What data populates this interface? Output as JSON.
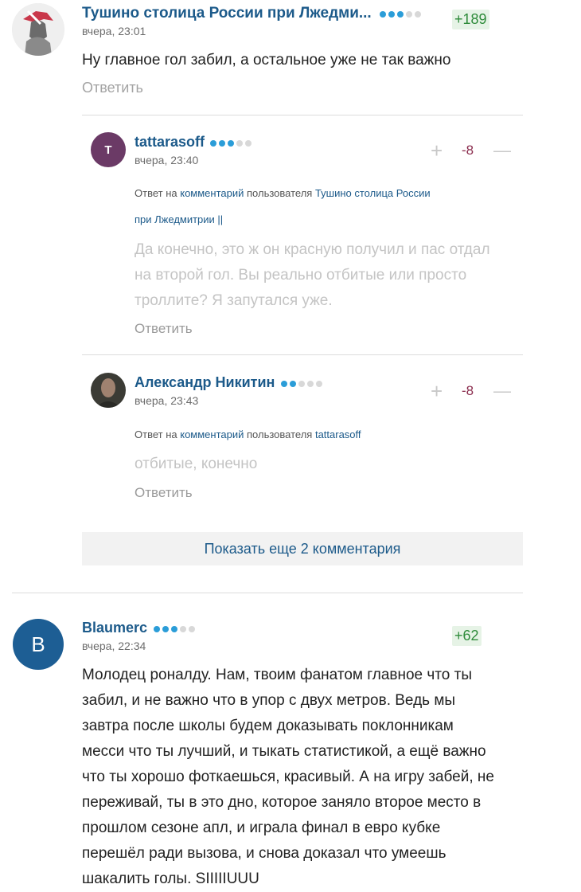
{
  "comment1": {
    "author": "Тушино столица России при Лжедми...",
    "time": "вчера, 23:01",
    "rating": "+189",
    "text": "Ну главное гол забил, а остальное уже не так важно",
    "reply_label": "Ответить",
    "level_dots": 3
  },
  "reply1": {
    "author": "tattarasoff",
    "avatar_letter": "T",
    "time": "вчера, 23:40",
    "rating": "-8",
    "meta_prefix": "Ответ на",
    "meta_link": "комментарий",
    "meta_mid": "пользователя",
    "meta_user": "Тушино столица России",
    "meta_user2": "при Лжедмитрии ||",
    "text_lines": [
      "Да конечно, это ж он красную получил и пас отдал",
      "на второй гол. Вы реально отбитые или просто",
      "троллите? Я запутался уже."
    ],
    "reply_label": "Ответить",
    "level_dots": 3
  },
  "reply2": {
    "author": "Александр Никитин",
    "time": "вчера, 23:43",
    "rating": "-8",
    "meta_prefix": "Ответ на",
    "meta_link": "комментарий",
    "meta_mid": "пользователя",
    "meta_user": "tattarasoff",
    "text": "отбитые, конечно",
    "reply_label": "Ответить",
    "level_dots": 2
  },
  "show_more": "Показать еще 2 комментария",
  "comment2": {
    "author": "Blaumerc",
    "avatar_letter": "B",
    "time": "вчера, 22:34",
    "rating": "+62",
    "text_lines": [
      "Молодец роналду. Нам, твоим фанатом главное что ты",
      "забил, и не важно что в упор с двух метров. Ведь мы",
      "завтра после школы будем доказывать поклонникам",
      "месси что ты лучший, и тыкать статистикой, а ещё важно",
      "что ты хорошо фоткаешься, красивый. А на игру забей, не",
      "переживай, ты в это дно, которое заняло второе место в",
      "прошлом сезоне апл, и играла финал в евро кубке",
      "перешёл ради вызова, и снова доказал что умеешь",
      "шакалить голы. SIIIIIUUU"
    ],
    "level_dots": 3
  },
  "vote_plus": "+",
  "vote_minus": "—",
  "colors": {
    "link": "#1c5a8a",
    "positive": "#2e8b3a",
    "negative": "#8b2d4e",
    "dot_active": "#2b9dd8"
  }
}
